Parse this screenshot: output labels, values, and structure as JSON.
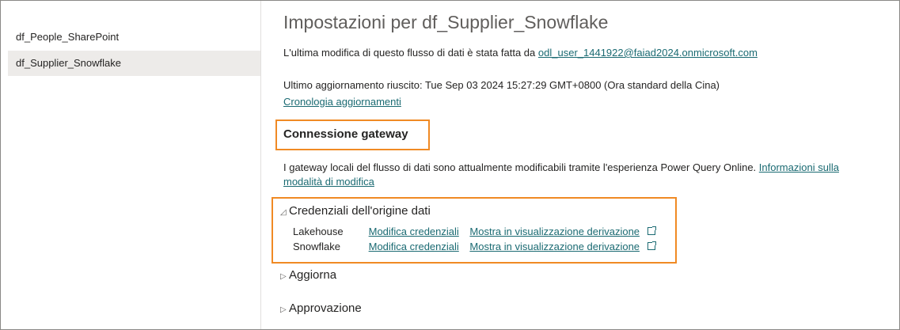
{
  "sidebar": {
    "items": [
      {
        "label": "df_People_SharePoint"
      },
      {
        "label": "df_Supplier_Snowflake"
      }
    ]
  },
  "main": {
    "title": "Impostazioni per df_Supplier_Snowflake",
    "last_modified_prefix": "L'ultima modifica di questo flusso di dati è stata fatta da",
    "last_modified_user": "odl_user_1441922@faiad2024.onmicrosoft.com",
    "last_refresh": "Ultimo aggiornamento riuscito: Tue Sep 03 2024 15:27:29 GMT+0800 (Ora standard della Cina)",
    "refresh_history_link": "Cronologia aggiornamenti",
    "gateway_heading": "Connessione gateway",
    "gateway_text": "I gateway locali del flusso di dati sono attualmente modificabili tramite l'esperienza Power Query Online.",
    "gateway_link_1": "Informazioni sulla",
    "gateway_link_2": "modalità di modifica",
    "credentials_section": "Credenziali dell'origine dati",
    "credentials": [
      {
        "source": "Lakehouse",
        "edit_label": "Modifica credenziali",
        "lineage_label": "Mostra in visualizzazione derivazione"
      },
      {
        "source": "Snowflake",
        "edit_label": "Modifica credenziali",
        "lineage_label": "Mostra in visualizzazione derivazione"
      }
    ],
    "refresh_section": "Aggiorna",
    "approval_section": "Approvazione"
  },
  "colors": {
    "link": "#1a6a72",
    "highlight": "#f08a24",
    "selected_bg": "#edebe9"
  }
}
